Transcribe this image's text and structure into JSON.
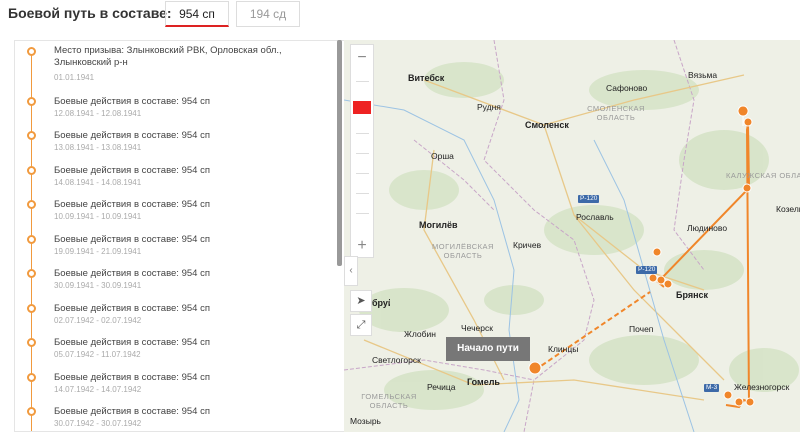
{
  "header": {
    "title": "Боевой путь в составе:",
    "tabs": [
      {
        "label": "954 сп",
        "active": true
      },
      {
        "label": "194 сд",
        "active": false
      }
    ]
  },
  "timeline": [
    {
      "title": "Место призыва: Злынковский РВК, Орловская обл., Злынковский р-н",
      "date": "01.01.1941"
    },
    {
      "title": "Боевые действия в составе: 954 сп",
      "date": "12.08.1941 - 12.08.1941"
    },
    {
      "title": "Боевые действия в составе: 954 сп",
      "date": "13.08.1941 - 13.08.1941"
    },
    {
      "title": "Боевые действия в составе: 954 сп",
      "date": "14.08.1941 - 14.08.1941"
    },
    {
      "title": "Боевые действия в составе: 954 сп",
      "date": "10.09.1941 - 10.09.1941"
    },
    {
      "title": "Боевые действия в составе: 954 сп",
      "date": "19.09.1941 - 21.09.1941"
    },
    {
      "title": "Боевые действия в составе: 954 сп",
      "date": "30.09.1941 - 30.09.1941"
    },
    {
      "title": "Боевые действия в составе: 954 сп",
      "date": "02.07.1942 - 02.07.1942"
    },
    {
      "title": "Боевые действия в составе: 954 сп",
      "date": "05.07.1942 - 11.07.1942"
    },
    {
      "title": "Боевые действия в составе: 954 сп",
      "date": "14.07.1942 - 14.07.1942"
    },
    {
      "title": "Боевые действия в составе: 954 сп",
      "date": "30.07.1942 - 30.07.1942"
    }
  ],
  "map": {
    "controls": {
      "zoom_in": "+",
      "zoom_out": "−",
      "collapse": "‹"
    },
    "tooltip": "Начало пути",
    "colors": {
      "route": "#f0862a",
      "accent": "#e22b2b"
    },
    "cities": [
      "Витебск",
      "Рудня",
      "Сафоново",
      "Вязьма",
      "Смоленск",
      "Орша",
      "Рославль",
      "Людиново",
      "Могилёв",
      "Кричев",
      "Брянск",
      "Козельск",
      "Жлобин",
      "Чечерск",
      "Клинцы",
      "Почеп",
      "Светлогорск",
      "Речица",
      "Гомель",
      "Железногорск",
      "Мозырь",
      "Бобруйск"
    ],
    "regions": [
      "СМОЛЕНСКАЯ ОБЛАСТЬ",
      "МОГИЛЁВСКАЯ ОБЛАСТЬ",
      "КАЛУЖСКАЯ ОБЛАСТЬ",
      "ГОМЕЛЬСКАЯ ОБЛАСТЬ"
    ],
    "roads": [
      "Р-120",
      "Р-120",
      "М-3"
    ]
  }
}
